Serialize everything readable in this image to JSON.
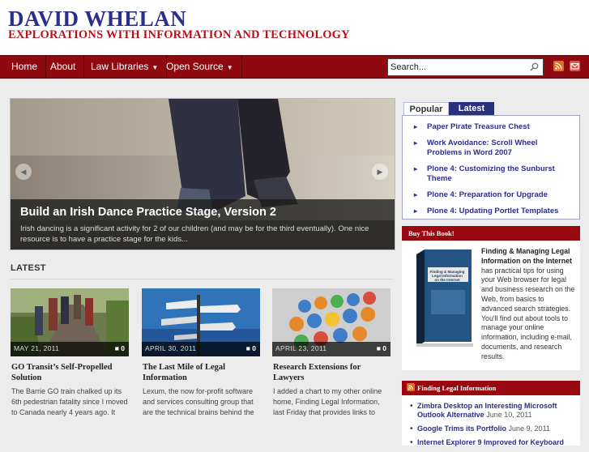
{
  "site": {
    "title": "DAVID WHELAN",
    "tagline": "EXPLORATIONS WITH INFORMATION AND TECHNOLOGY"
  },
  "nav": {
    "items": [
      "Home",
      "About",
      "Law Libraries",
      "Open Source"
    ],
    "search_value": "Search..."
  },
  "icons": {
    "search": "search-icon",
    "rss": "rss-icon",
    "email": "email-icon"
  },
  "slider": {
    "title": "Build an Irish Dance Practice Stage, Version 2",
    "excerpt": "Irish dancing is a significant activity for 2 of our children (and may be for the third eventually). One nice resource is to have a practice stage for the kids..."
  },
  "latest": {
    "heading": "LATEST",
    "posts": [
      {
        "date": "MAY 21, 2011",
        "comments": "0",
        "title": "GO Transit’s Self-Propelled Solution",
        "excerpt": "The Barrie GO train chalked up its 6th pedestrian fatality since I moved to Canada nearly 4 years ago.  It"
      },
      {
        "date": "APRIL 30, 2011",
        "comments": "0",
        "title": "The Last Mile of Legal Information",
        "excerpt": "Lexum, the now for-profit software and services consulting group that are the technical brains behind the"
      },
      {
        "date": "APRIL 23, 2011",
        "comments": "0",
        "title": "Research Extensions for Lawyers",
        "excerpt": "I added a chart to my other online home, Finding Legal Information, last Friday that provides links to"
      }
    ]
  },
  "tabs": {
    "popular_label": "Popular",
    "latest_label": "Latest",
    "items": [
      "Paper Pirate Treasure Chest",
      "Work Avoidance: Scroll Wheel Problems in Word 2007",
      "Plone 4: Customizing the Sunburst Theme",
      "Plone 4: Preparation for Upgrade",
      "Plone 4: Updating Portlet Templates"
    ]
  },
  "book": {
    "heading": "Buy This Book!",
    "cover_title": "Finding & Managing Legal Information on the Internet",
    "title": "Finding & Managing Legal Information on the Internet",
    "description": " has practical tips for using your Web browser for legal and business research on the Web, from basics to advanced search strategies. You'll find out about tools to manage your online information, including e-mail, documents, and research results."
  },
  "legal": {
    "heading": "Finding Legal Information",
    "items": [
      {
        "title": "Zimbra Desktop an Interesting Microsoft Outlook Alternative",
        "date": "June 10, 2011"
      },
      {
        "title": "Google Trims its Portfolio",
        "date": "June 9, 2011"
      },
      {
        "title": "Internet Explorer 9 Improved for Keyboard",
        "date": ""
      }
    ]
  },
  "colors": {
    "brand_blue": "#2b2f8a",
    "brand_red": "#b5121b",
    "nav_bg": "#8f0a10"
  }
}
